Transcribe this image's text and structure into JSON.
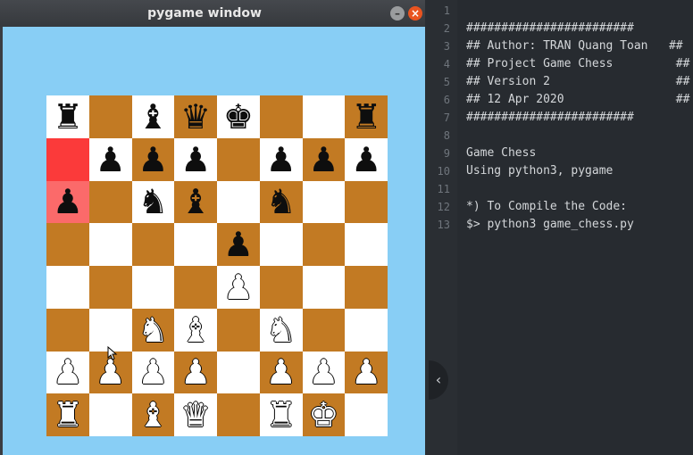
{
  "window": {
    "title": "pygame window",
    "minimize_icon": "minimize-icon",
    "close_icon": "close-icon"
  },
  "board": {
    "rows": [
      [
        "bR",
        "",
        "bB",
        "bQ",
        "bK",
        "",
        "",
        "bR"
      ],
      [
        "",
        "bP",
        "bP",
        "bP",
        "",
        "bP",
        "bP",
        "bP"
      ],
      [
        "bP",
        "",
        "bN",
        "bB",
        "",
        "bN",
        "",
        ""
      ],
      [
        "",
        "",
        "",
        "",
        "bP",
        "",
        "",
        ""
      ],
      [
        "",
        "",
        "",
        "",
        "wP",
        "",
        "",
        ""
      ],
      [
        "",
        "",
        "wN",
        "wB",
        "",
        "wN",
        "",
        ""
      ],
      [
        "wP",
        "wP",
        "wP",
        "wP",
        "",
        "wP",
        "wP",
        "wP"
      ],
      [
        "wR",
        "",
        "wB",
        "wQ",
        "",
        "wR",
        "wK",
        ""
      ]
    ],
    "highlighted_squares": [
      "1-0",
      "2-0"
    ],
    "colors": {
      "light": "#ffffff",
      "dark": "#c27a23",
      "highlight": "#fb3a3a",
      "background": "#88cef5"
    }
  },
  "editor": {
    "lines": [
      {
        "n": "1",
        "text": ""
      },
      {
        "n": "2",
        "text": "########################"
      },
      {
        "n": "3",
        "text": "## Author: TRAN Quang Toan   ##"
      },
      {
        "n": "4",
        "text": "## Project Game Chess         ##"
      },
      {
        "n": "5",
        "text": "## Version 2                  ##"
      },
      {
        "n": "6",
        "text": "## 12 Apr 2020                ##"
      },
      {
        "n": "7",
        "text": "########################"
      },
      {
        "n": "8",
        "text": ""
      },
      {
        "n": "9",
        "text": "Game Chess"
      },
      {
        "n": "10",
        "text": "Using python3, pygame"
      },
      {
        "n": "11",
        "text": ""
      },
      {
        "n": "12",
        "text": "*) To Compile the Code:"
      },
      {
        "n": "13",
        "text": "$> python3 game_chess.py"
      }
    ],
    "collapse_glyph": "‹"
  }
}
